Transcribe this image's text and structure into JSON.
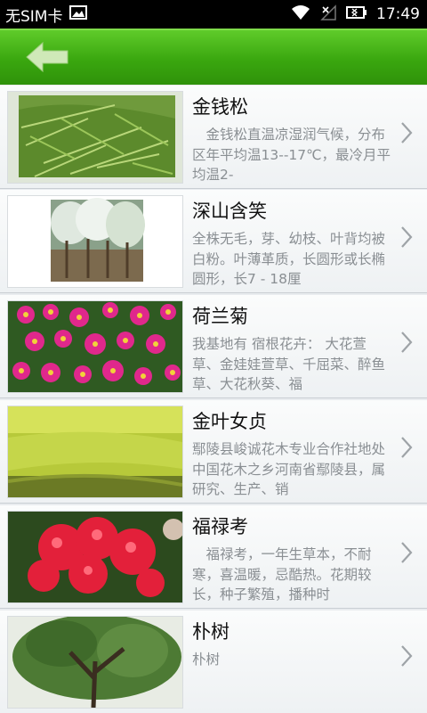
{
  "status_bar": {
    "carrier": "无SIM卡",
    "time": "17:49",
    "icons": [
      "image-icon",
      "wifi-icon",
      "no-signal-icon",
      "battery-icon"
    ]
  },
  "app_bar": {
    "back_icon": "back-arrow-icon",
    "colors": {
      "bar_top": "#5fcb2a",
      "bar_bottom": "#2f920a",
      "arrow": "#cfe9b8"
    }
  },
  "plants": [
    {
      "name": "金钱松",
      "desc": "　金钱松直温凉湿润气候，分布区年平均温13--17℃，最冷月平均温2-",
      "image": "pine-foliage-photo"
    },
    {
      "name": "深山含笑",
      "desc": "全株无毛，芽、幼枝、叶背均被白粉。叶薄革质，长圆形或长椭圆形，长7 - 18厘",
      "image": "flowering-trees-photo"
    },
    {
      "name": "荷兰菊",
      "desc": "我基地有 宿根花卉： 大花萱草、金娃娃萱草、千屈菜、醉鱼草、大花秋葵、福",
      "image": "pink-asters-photo"
    },
    {
      "name": "金叶女贞",
      "desc": "鄢陵县峻诚花木专业合作社地处中国花木之乡河南省鄢陵县，属研究、生产、销",
      "image": "yellow-shrub-photo"
    },
    {
      "name": "福禄考",
      "desc": "　福禄考，一年生草本，不耐寒，喜温暖，忌酷热。花期较长，种子繁殖，播种时",
      "image": "red-phlox-photo"
    },
    {
      "name": "朴树",
      "desc": "朴树",
      "image": "tree-canopy-photo"
    }
  ]
}
